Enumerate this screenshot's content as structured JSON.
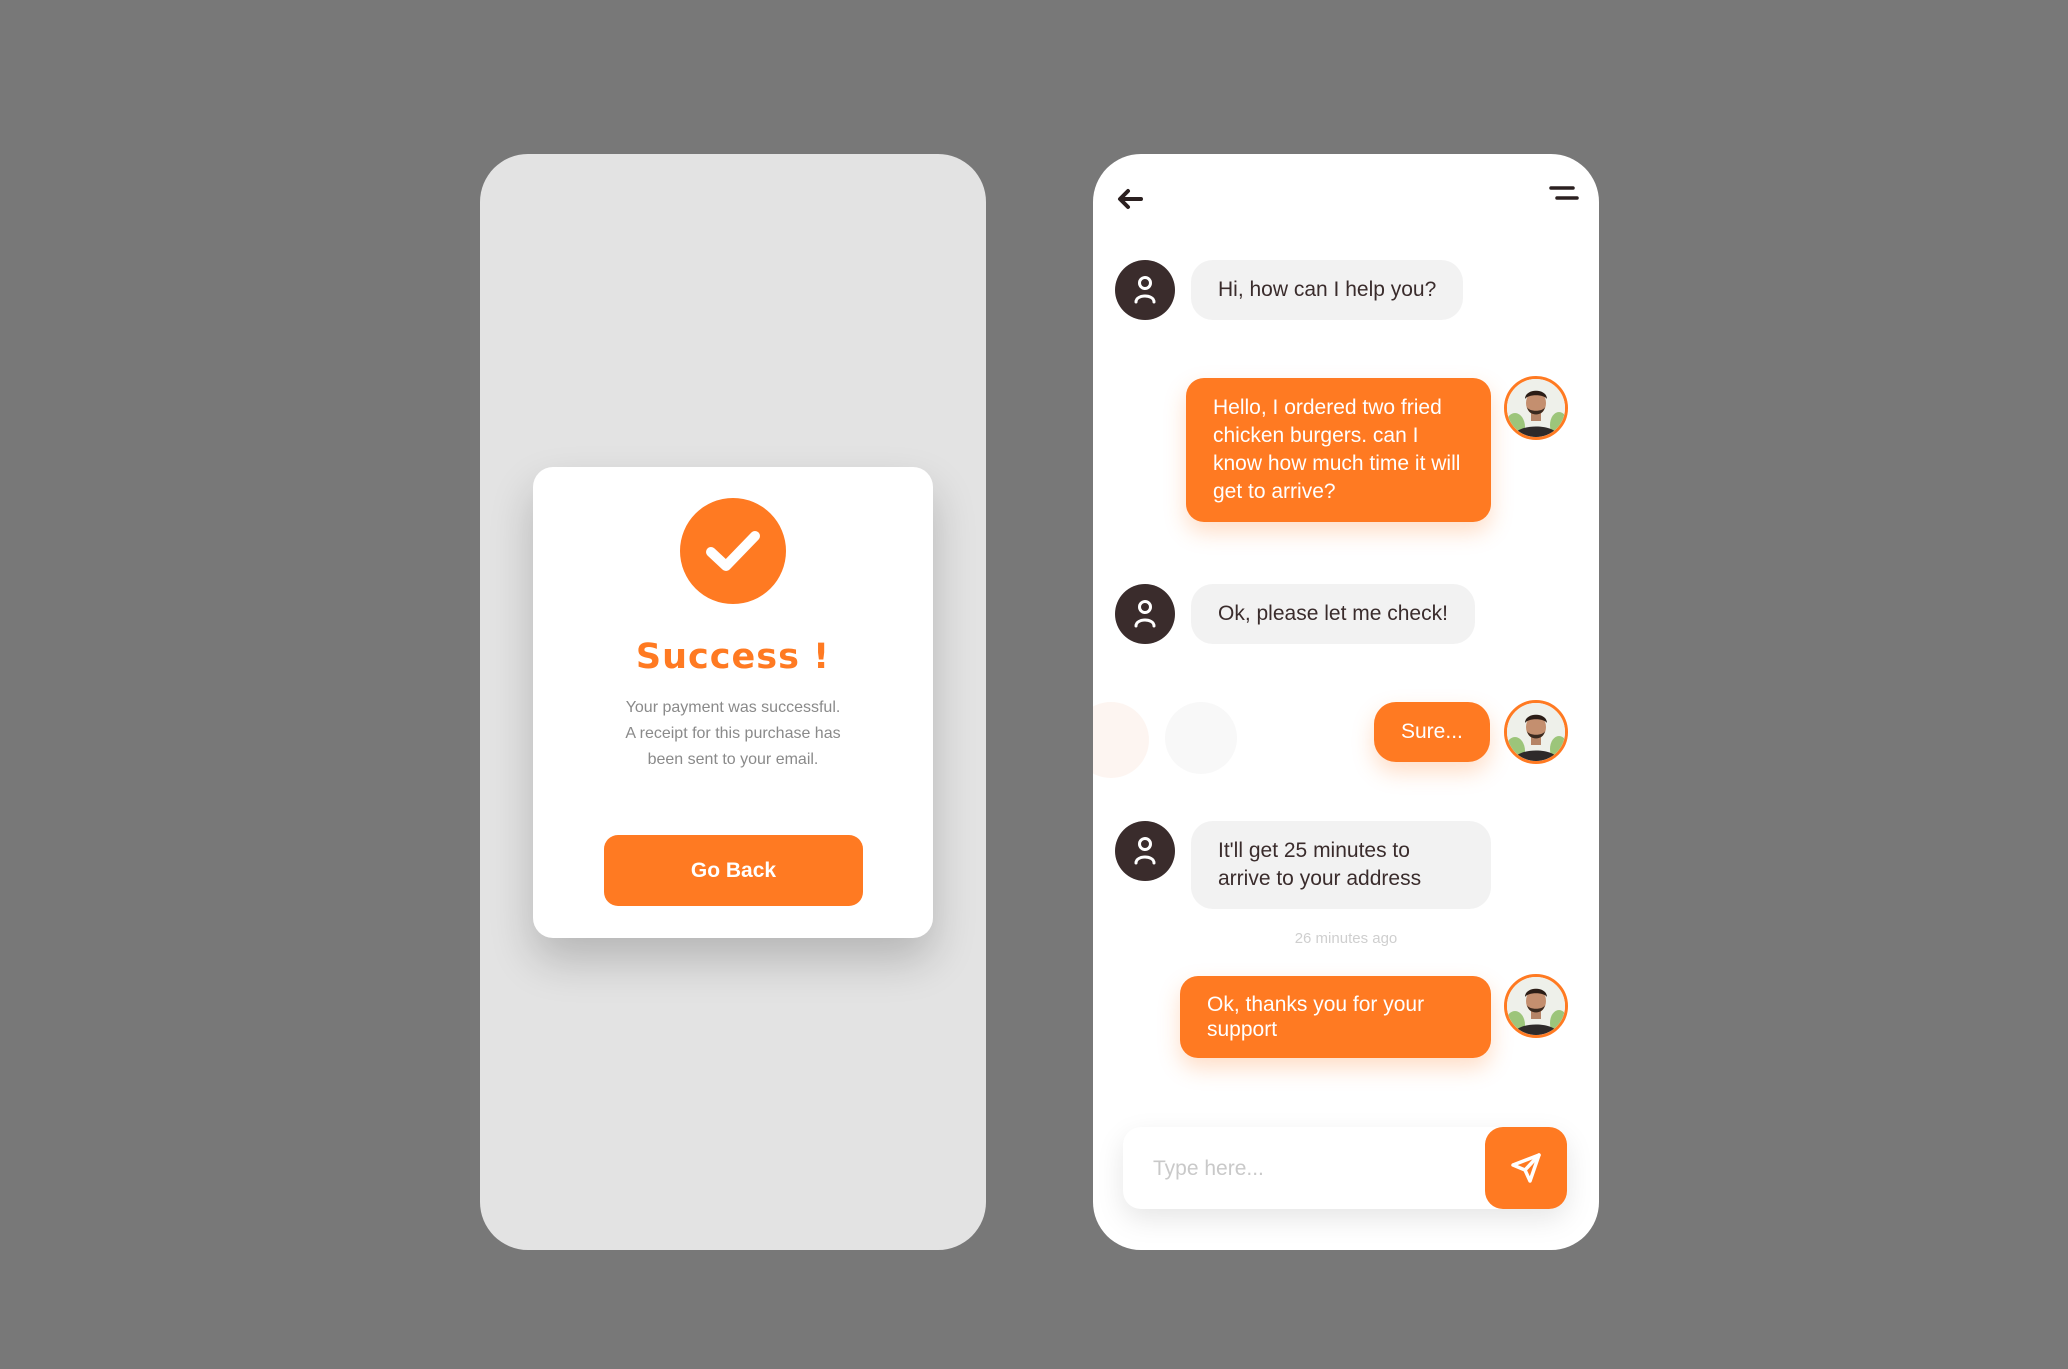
{
  "colors": {
    "background": "#787878",
    "accent": "#ff7a22",
    "agent_avatar": "#3a2c2c",
    "incoming_bubble": "#f2f2f2"
  },
  "success_screen": {
    "icon": "checkmark-icon",
    "title": "Success !",
    "message_lines": [
      "Your payment was successful.",
      "A receipt for this purchase has",
      "been sent to your email."
    ],
    "button_label": "Go Back"
  },
  "chat_screen": {
    "header": {
      "back_icon": "back-arrow-icon",
      "menu_icon": "menu-icon"
    },
    "messages": [
      {
        "from": "agent",
        "text": "Hi, how can I help you?"
      },
      {
        "from": "user",
        "text": "Hello, I ordered two fried chicken burgers. can I know how much time it will get to arrive?"
      },
      {
        "from": "agent",
        "text": "Ok, please let me check!"
      },
      {
        "from": "user",
        "text": "Sure..."
      },
      {
        "from": "agent",
        "text": "It'll get 25 minutes to arrive to your address"
      },
      {
        "from": "user",
        "text": "Ok, thanks you for your support"
      }
    ],
    "timestamp": "26 minutes ago",
    "input": {
      "placeholder": "Type here...",
      "value": ""
    },
    "send_icon": "send-icon"
  }
}
